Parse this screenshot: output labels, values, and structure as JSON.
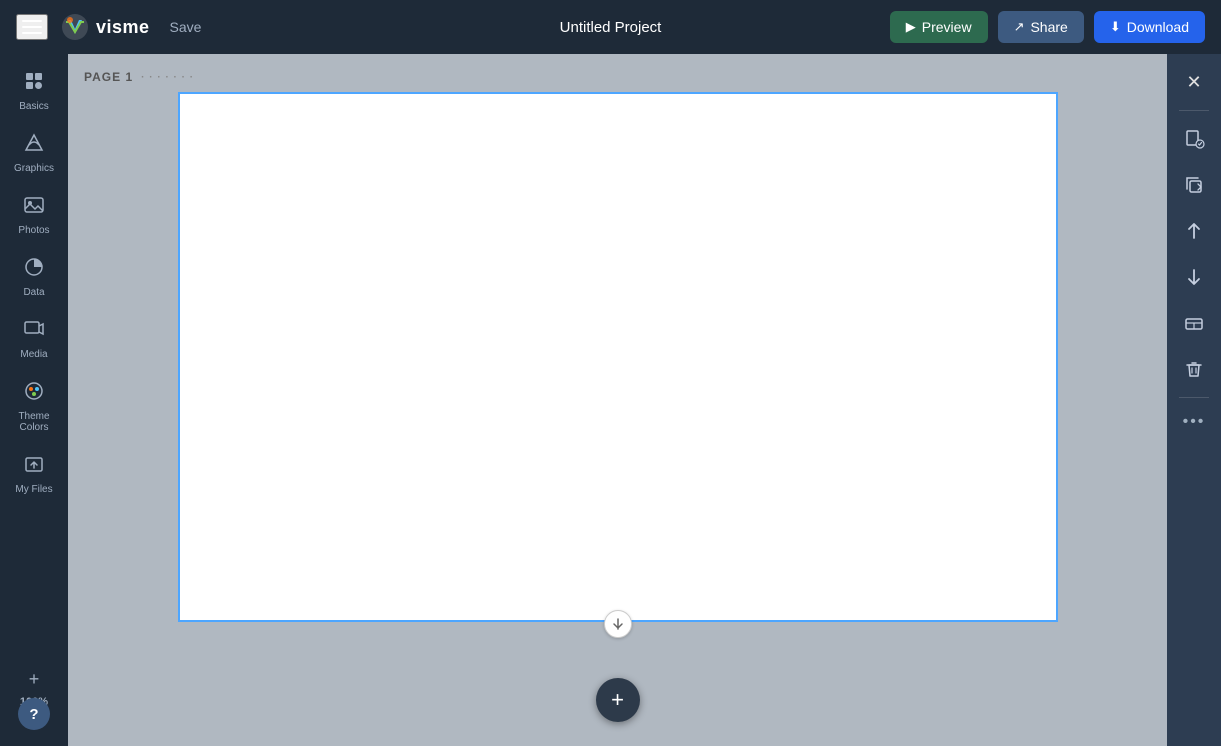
{
  "topbar": {
    "save_label": "Save",
    "project_title": "Untitled Project",
    "preview_label": "Preview",
    "share_label": "Share",
    "download_label": "Download"
  },
  "sidebar": {
    "items": [
      {
        "id": "basics",
        "label": "Basics",
        "icon": "⬡"
      },
      {
        "id": "graphics",
        "label": "Graphics",
        "icon": "◇"
      },
      {
        "id": "photos",
        "label": "Photos",
        "icon": "⊞"
      },
      {
        "id": "data",
        "label": "Data",
        "icon": "◑"
      },
      {
        "id": "media",
        "label": "Media",
        "icon": "▶"
      },
      {
        "id": "theme-colors",
        "label": "Theme Colors",
        "icon": "⬤"
      },
      {
        "id": "my-files",
        "label": "My Files",
        "icon": "↑"
      }
    ]
  },
  "canvas": {
    "page_label": "PAGE 1"
  },
  "zoom": {
    "level": "100%"
  },
  "right_panel": {
    "buttons": [
      {
        "id": "close",
        "icon": "✕",
        "label": "close"
      },
      {
        "id": "page-settings",
        "icon": "⊙",
        "label": "page settings"
      },
      {
        "id": "duplicate",
        "icon": "⧉",
        "label": "duplicate"
      },
      {
        "id": "move-up",
        "icon": "↑",
        "label": "move up"
      },
      {
        "id": "move-down",
        "icon": "↓",
        "label": "move down"
      },
      {
        "id": "layout",
        "icon": "▭",
        "label": "layout"
      },
      {
        "id": "delete",
        "icon": "🗑",
        "label": "delete"
      }
    ],
    "more_label": "•••"
  }
}
